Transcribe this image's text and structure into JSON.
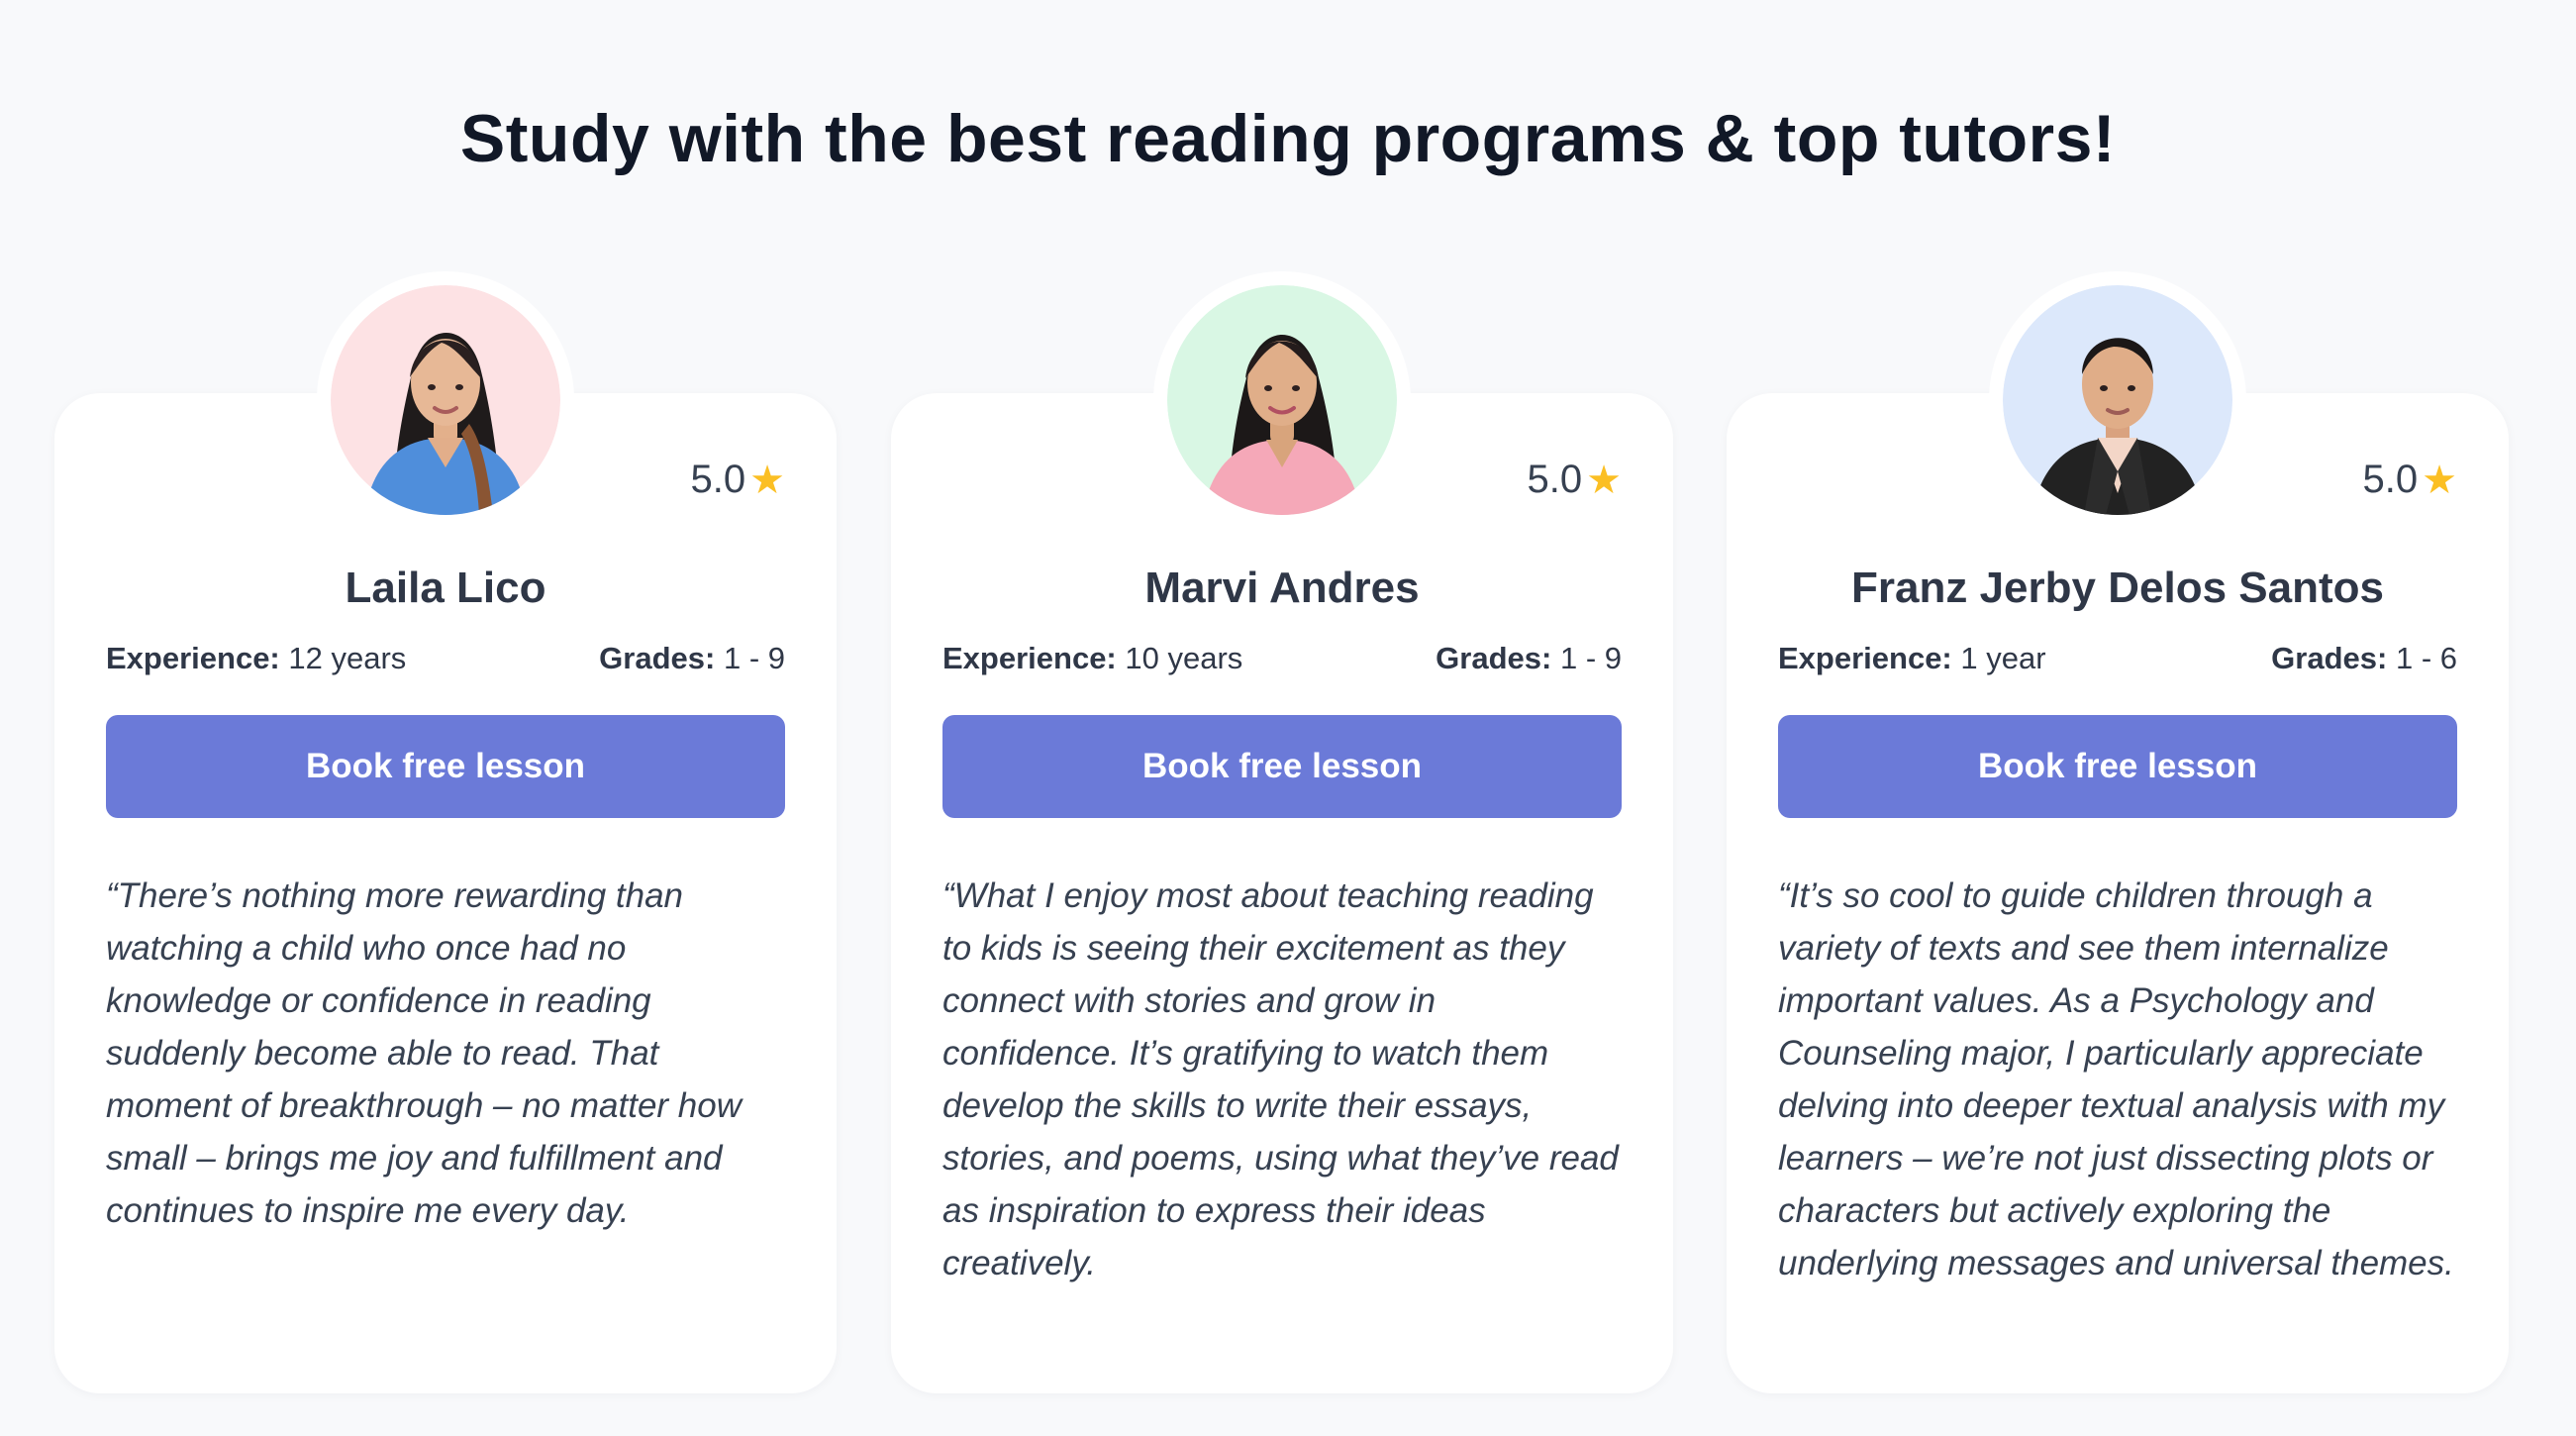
{
  "page": {
    "title": "Study with the best reading programs & top tutors!"
  },
  "colors": {
    "background": "#f8f9fb",
    "card": "#ffffff",
    "button": "#6b7ad8",
    "star": "#fbbf24",
    "avatar_bg_1": "#fde2e4",
    "avatar_bg_2": "#d9f7e4",
    "avatar_bg_3": "#dce8fb"
  },
  "labels": {
    "experience": "Experience:",
    "grades": "Grades:",
    "button": "Book free lesson"
  },
  "tutors": [
    {
      "name": "Laila Lico",
      "rating": "5.0",
      "experience": "12 years",
      "grades": "1 - 9",
      "quote": "“There’s nothing more rewarding than watching a child who once had no knowledge or confidence in reading suddenly become able to read. That moment of breakthrough – no matter how small – brings me joy and fulfillment and continues to inspire me every day."
    },
    {
      "name": "Marvi Andres",
      "rating": "5.0",
      "experience": "10 years",
      "grades": "1 - 9",
      "quote": "“What I enjoy most about teaching reading to kids is seeing their excitement as they connect with stories and grow in confidence. It’s gratifying to watch them develop the skills to write their essays, stories, and poems, using what they’ve read as inspiration to express their ideas creatively."
    },
    {
      "name": "Franz Jerby Delos Santos",
      "rating": "5.0",
      "experience": "1 year",
      "grades": "1 - 6",
      "quote": "“It’s so cool to guide children through a variety of texts and see them internalize important values. As a Psychology and Counseling major, I particularly appreciate delving into deeper textual analysis with my learners – we’re not just dissecting plots or characters but actively exploring the underlying messages and universal themes."
    }
  ]
}
